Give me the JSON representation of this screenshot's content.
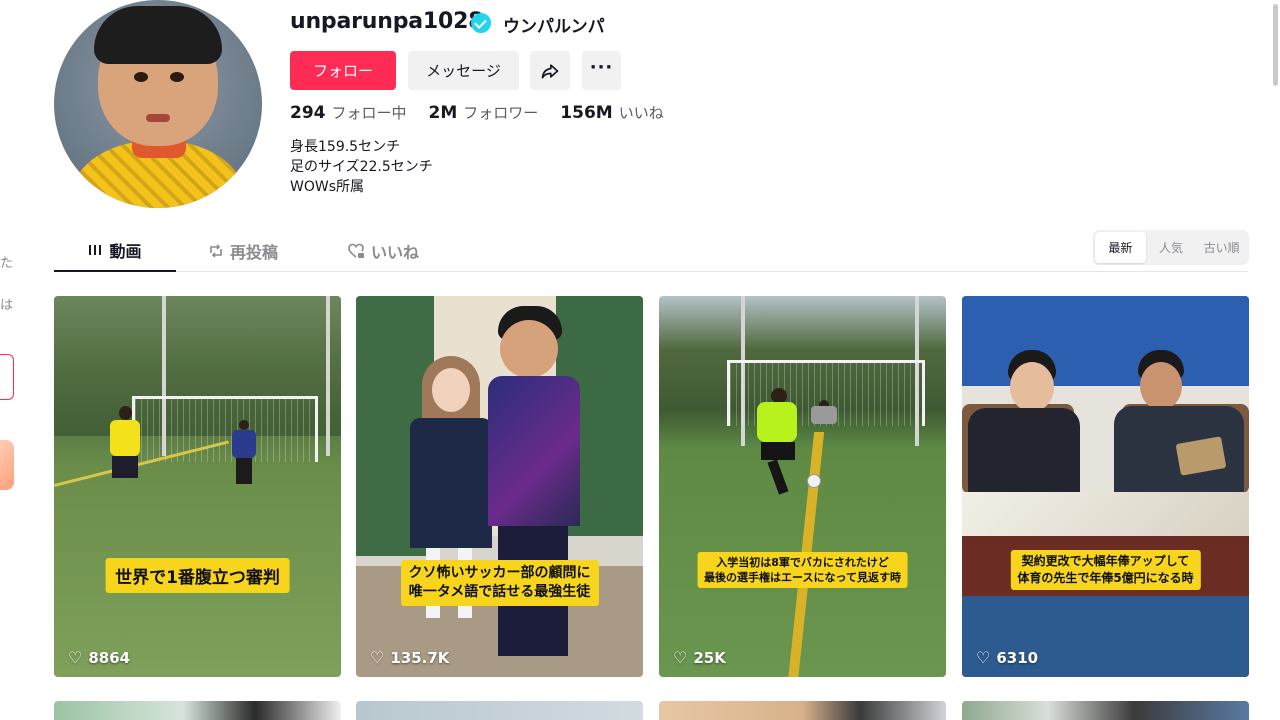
{
  "profile": {
    "username": "unparunpa1028",
    "nickname": "ウンパルンパ",
    "follow_label": "フォロー",
    "message_label": "メッセージ",
    "more_label": "···",
    "stats": {
      "following_count": "294",
      "following_label": "フォロー中",
      "followers_count": "2M",
      "followers_label": "フォロワー",
      "likes_count": "156M",
      "likes_label": "いいね"
    },
    "bio": [
      "身長159.5センチ",
      "足のサイズ22.5センチ",
      "WOWs所属"
    ]
  },
  "sidebar_sliver": {
    "text1": "た",
    "text2": "は"
  },
  "tabs": {
    "videos": "動画",
    "reposts": "再投稿",
    "liked": "いいね"
  },
  "sort": {
    "options": [
      "最新",
      "人気",
      "古い順"
    ],
    "selected": "最新"
  },
  "videos": [
    {
      "caption": "世界で1番腹立つ審判",
      "likes": "8864"
    },
    {
      "caption_line1": "クソ怖いサッカー部の顧問に",
      "caption_line2": "唯一タメ語で話せる最強生徒",
      "likes": "135.7K"
    },
    {
      "caption_line1": "入学当初は8軍でバカにされたけど",
      "caption_line2": "最後の選手権はエースになって見返す時",
      "likes": "25K"
    },
    {
      "caption_line1": "契約更改で大幅年俸アップして",
      "caption_line2": "体育の先生で年俸5億円になる時",
      "likes": "6310"
    }
  ],
  "colors": {
    "accent": "#fe2c55",
    "verified": "#20d5ec",
    "caption_bg": "#f6d51c",
    "text_primary": "#161823",
    "text_secondary": "#8a8b91"
  }
}
